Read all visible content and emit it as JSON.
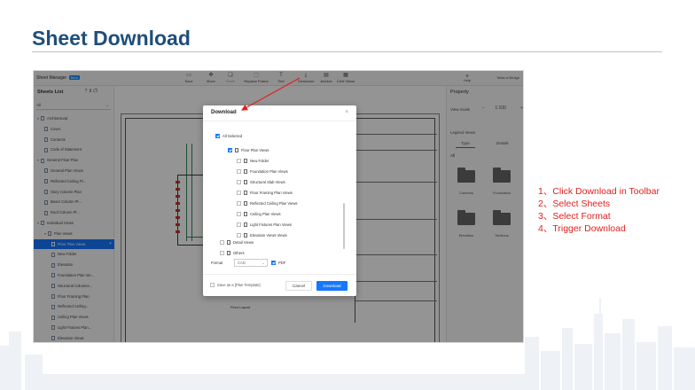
{
  "slide": {
    "title": "Sheet Download",
    "steps": [
      "1、Click Download in Toolbar",
      "2、Select Sheets",
      "3、Select Format",
      "4、Trigger Download"
    ],
    "accent_color": "#e0201b",
    "title_color": "#1f4e79"
  },
  "app": {
    "topbar": {
      "sheet_manager": "Sheet Manager",
      "badge": "Beta",
      "toolbar": [
        {
          "label": "Save",
          "icon": "save-icon"
        },
        {
          "label": "Move",
          "icon": "move-icon"
        },
        {
          "label": "Paste",
          "icon": "paste-icon",
          "disabled": true
        },
        {
          "label": "Replace Frame",
          "icon": "frame-icon"
        },
        {
          "label": "Text",
          "icon": "text-icon"
        },
        {
          "label": "Download",
          "icon": "download-icon"
        },
        {
          "label": "Archive",
          "icon": "archive-icon"
        },
        {
          "label": "CAN Views",
          "icon": "views-icon"
        }
      ],
      "help": "Help",
      "user": "Tekla w Bridge"
    },
    "left_panel": {
      "title": "Sheets List",
      "filter_value": "All",
      "tree": [
        {
          "label": "Architectural",
          "level": 0,
          "type": "group"
        },
        {
          "label": "Cover",
          "level": 1,
          "type": "doc"
        },
        {
          "label": "Contents",
          "level": 1,
          "type": "doc"
        },
        {
          "label": "Code of Statement",
          "level": 1,
          "type": "doc"
        },
        {
          "label": "General Floor Plan",
          "level": 0,
          "type": "group"
        },
        {
          "label": "General Plan Views",
          "level": 1,
          "type": "doc"
        },
        {
          "label": "Reflected Ceiling Pl...",
          "level": 1,
          "type": "doc"
        },
        {
          "label": "Story Column Plan",
          "level": 1,
          "type": "doc"
        },
        {
          "label": "Beam Column Pl...",
          "level": 1,
          "type": "doc"
        },
        {
          "label": "Roof Column Pl...",
          "level": 1,
          "type": "doc"
        },
        {
          "label": "Individual Views",
          "level": 0,
          "type": "group"
        },
        {
          "label": "Plan Views",
          "level": 1,
          "type": "group"
        },
        {
          "label": "Floor Plan Views",
          "level": 2,
          "type": "doc",
          "selected": true
        },
        {
          "label": "New Folder",
          "level": 2,
          "type": "doc"
        },
        {
          "label": "Elevation",
          "level": 2,
          "type": "doc"
        },
        {
          "label": "Foundation Plan Vie...",
          "level": 2,
          "type": "doc"
        },
        {
          "label": "Structural Columns...",
          "level": 2,
          "type": "doc"
        },
        {
          "label": "Floor Framing Plan",
          "level": 2,
          "type": "doc"
        },
        {
          "label": "Reflected Ceiling...",
          "level": 2,
          "type": "doc"
        },
        {
          "label": "Ceiling Plan Views",
          "level": 2,
          "type": "doc"
        },
        {
          "label": "Light Fixtures Plan...",
          "level": 2,
          "type": "doc"
        },
        {
          "label": "Elevation Views",
          "level": 2,
          "type": "doc"
        }
      ]
    },
    "canvas": {
      "floor_label": "Floor Layout"
    },
    "right_panel": {
      "title": "Property",
      "view_scale_label": "View Scale",
      "view_scale_value": "1:100",
      "legend_views": "Legend Views",
      "tabs": [
        "Type",
        "Details"
      ],
      "all_label": "All",
      "folders": [
        "Columns",
        "Foundation",
        "Elevation",
        "Sections"
      ]
    }
  },
  "dialog": {
    "title": "Download",
    "close": "×",
    "select_all": "All Selected",
    "items": [
      {
        "label": "Floor Plan Views",
        "checked": true,
        "level": 1
      },
      {
        "label": "New Folder",
        "checked": false,
        "level": 2
      },
      {
        "label": "Foundation Plan Views",
        "checked": false,
        "level": 2
      },
      {
        "label": "Structural Slab Views",
        "checked": false,
        "level": 2
      },
      {
        "label": "Floor Framing Plan Views",
        "checked": false,
        "level": 2
      },
      {
        "label": "Reflected Ceiling Plan Views",
        "checked": false,
        "level": 2
      },
      {
        "label": "Ceiling Plan Views",
        "checked": false,
        "level": 2
      },
      {
        "label": "Light Fixtures Plan Views",
        "checked": false,
        "level": 2
      },
      {
        "label": "Elevation Views Views",
        "checked": false,
        "level": 2
      },
      {
        "label": "Detail Views",
        "checked": false,
        "level": 1
      },
      {
        "label": "Others",
        "checked": false,
        "level": 1
      }
    ],
    "format_label": "Format",
    "format_value": "CAD",
    "pdf_label": "PDF",
    "save_template": "Save as a [Plan Template]",
    "cancel": "Cancel",
    "download": "Download"
  }
}
